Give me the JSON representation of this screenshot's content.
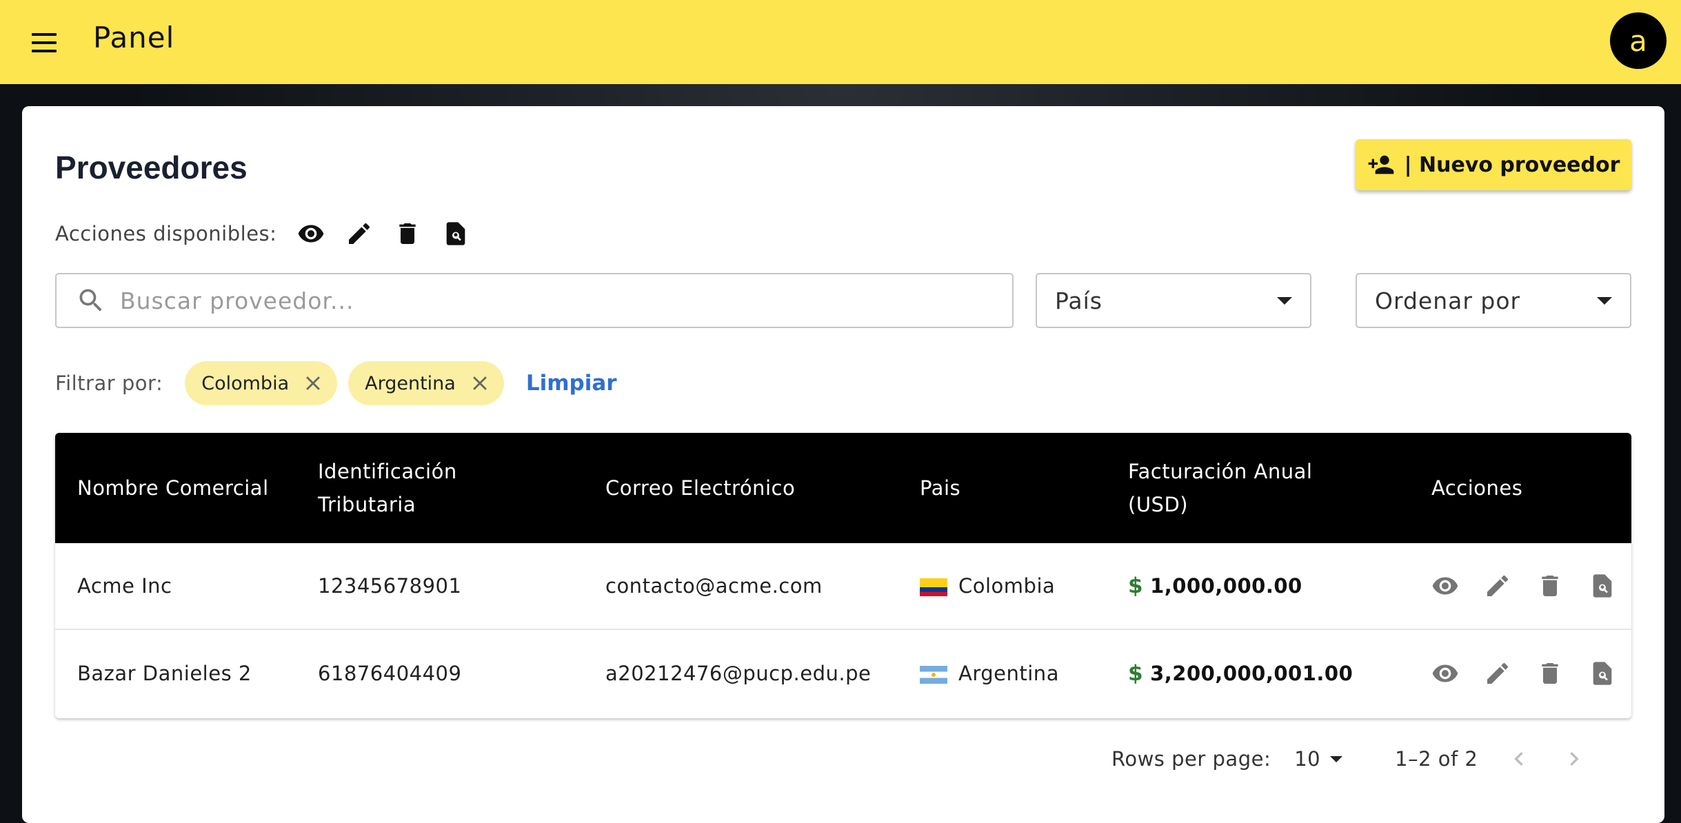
{
  "appbar": {
    "title": "Panel",
    "avatar_letter": "a"
  },
  "page": {
    "title": "Proveedores",
    "new_button_label": "| Nuevo proveedor"
  },
  "actions_legend": {
    "label": "Acciones disponibles:",
    "icons": [
      "eye-icon",
      "pencil-icon",
      "trash-icon",
      "search-document-icon"
    ]
  },
  "search": {
    "placeholder": "Buscar proveedor..."
  },
  "filters": {
    "country_select": "País",
    "sort_select": "Ordenar por",
    "label": "Filtrar por:",
    "chips": [
      "Colombia",
      "Argentina"
    ],
    "clear_label": "Limpiar"
  },
  "table": {
    "headers": {
      "name": "Nombre Comercial",
      "tax_id": "Identificación Tributaria",
      "email": "Correo Electrónico",
      "country": "Pais",
      "billing": "Facturación Anual (USD)",
      "actions": "Acciones"
    },
    "rows": [
      {
        "name": "Acme Inc",
        "tax_id": "12345678901",
        "email": "contacto@acme.com",
        "country": "Colombia",
        "currency_sign": "$",
        "billing": "1,000,000.00"
      },
      {
        "name": "Bazar Danieles 2",
        "tax_id": "61876404409",
        "email": "a20212476@pucp.edu.pe",
        "country": "Argentina",
        "currency_sign": "$",
        "billing": "3,200,000,001.00"
      }
    ]
  },
  "pagination": {
    "rows_per_page_label": "Rows per page:",
    "rows_per_page_value": "10",
    "range": "1–2 of 2"
  },
  "colors": {
    "brand_yellow": "#fce54f",
    "chip_yellow": "#fbefa4",
    "link_blue": "#2f6fd1",
    "money_green": "#2e7d32"
  }
}
